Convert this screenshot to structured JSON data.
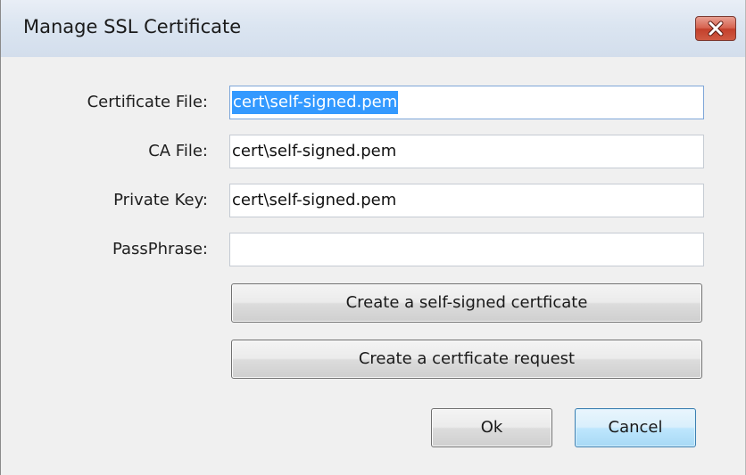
{
  "window": {
    "title": "Manage SSL Certificate"
  },
  "form": {
    "certificate_file": {
      "label": "Certificate File:",
      "value": "cert\\self-signed.pem"
    },
    "ca_file": {
      "label": "CA File:",
      "value": "cert\\self-signed.pem"
    },
    "private_key": {
      "label": "Private Key:",
      "value": "cert\\self-signed.pem"
    },
    "passphrase": {
      "label": "PassPhrase:",
      "value": ""
    }
  },
  "actions": {
    "create_self_signed": "Create a self-signed certficate",
    "create_request": "Create a certficate request",
    "ok": "Ok",
    "cancel": "Cancel"
  },
  "icons": {
    "close": "close-icon"
  },
  "colors": {
    "selection": "#3399ff",
    "close_button": "#c3402b",
    "default_button": "#bee6fd"
  }
}
